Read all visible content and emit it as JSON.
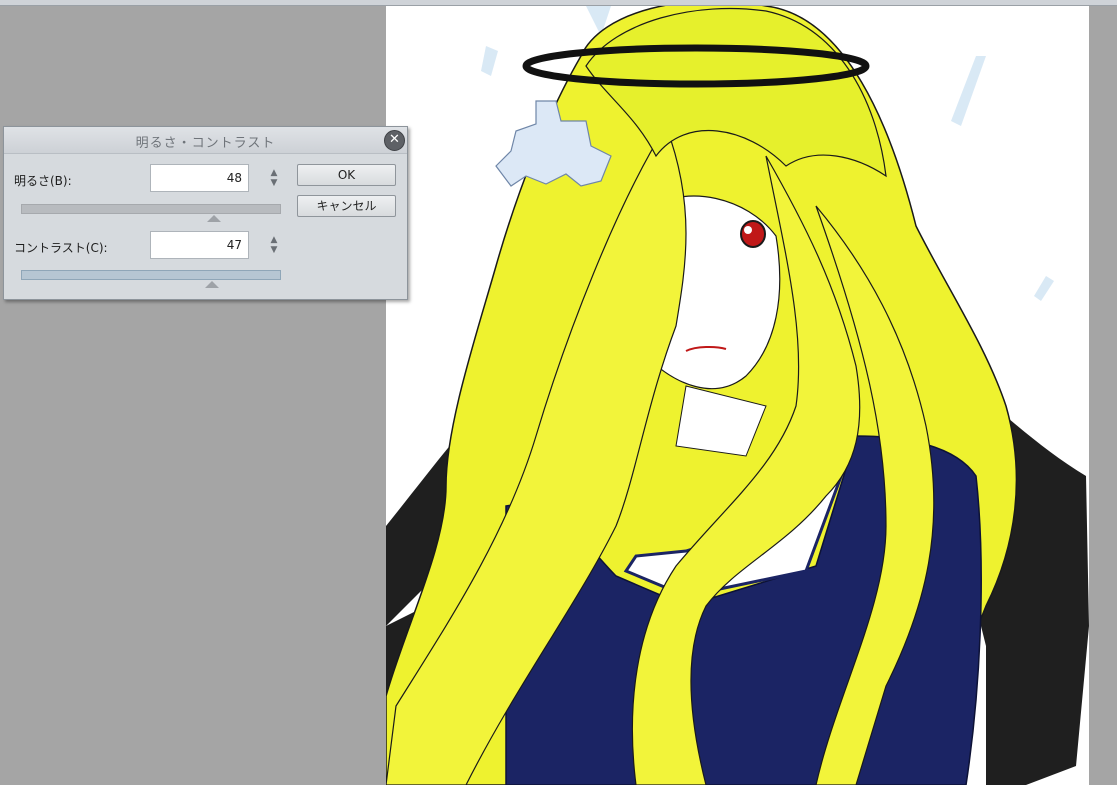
{
  "dialog": {
    "title": "明るさ・コントラスト",
    "brightness_label": "明るさ(B):",
    "brightness_value": "48",
    "contrast_label": "コントラスト(C):",
    "contrast_value": "47",
    "ok_label": "OK",
    "cancel_label": "キャンセル",
    "close_symbol": "✕"
  },
  "colors": {
    "workspace": "#a5a5a5",
    "dialog_bg": "#d6dade",
    "hair_yellow": "#e8ef2a",
    "uniform_navy": "#1b2464",
    "wings_black": "#1f1f1f"
  },
  "icons": {
    "close": "close-icon",
    "spin": "spin-arrows-icon"
  }
}
